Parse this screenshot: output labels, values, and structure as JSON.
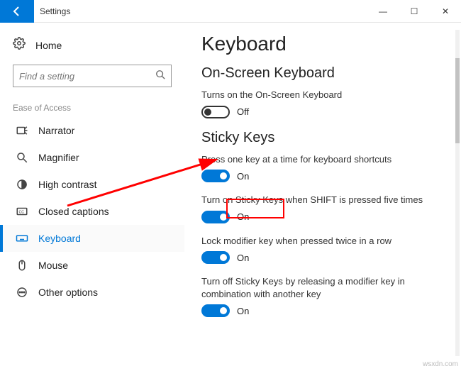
{
  "window": {
    "title": "Settings",
    "controls": {
      "min": "—",
      "max": "☐",
      "close": "✕"
    }
  },
  "sidebar": {
    "home_label": "Home",
    "search_placeholder": "Find a setting",
    "section_header": "Ease of Access",
    "items": [
      {
        "label": "Narrator",
        "icon": "narrator"
      },
      {
        "label": "Magnifier",
        "icon": "magnifier"
      },
      {
        "label": "High contrast",
        "icon": "contrast"
      },
      {
        "label": "Closed captions",
        "icon": "cc"
      },
      {
        "label": "Keyboard",
        "icon": "keyboard",
        "active": true
      },
      {
        "label": "Mouse",
        "icon": "mouse"
      },
      {
        "label": "Other options",
        "icon": "other"
      }
    ]
  },
  "main": {
    "title": "Keyboard",
    "sections": [
      {
        "header": "On-Screen Keyboard",
        "settings": [
          {
            "desc": "Turns on the On-Screen Keyboard",
            "state": "off",
            "state_label": "Off"
          }
        ]
      },
      {
        "header": "Sticky Keys",
        "settings": [
          {
            "desc": "Press one key at a time for keyboard shortcuts",
            "state": "on",
            "state_label": "On",
            "highlighted": true
          },
          {
            "desc": "Turn on Sticky Keys when SHIFT is pressed five times",
            "state": "on",
            "state_label": "On"
          },
          {
            "desc": "Lock modifier key when pressed twice in a row",
            "state": "on",
            "state_label": "On"
          },
          {
            "desc": "Turn off Sticky Keys by releasing a modifier key in combination with another key",
            "state": "on",
            "state_label": "On"
          }
        ]
      }
    ]
  },
  "watermark": "wsxdn.com"
}
